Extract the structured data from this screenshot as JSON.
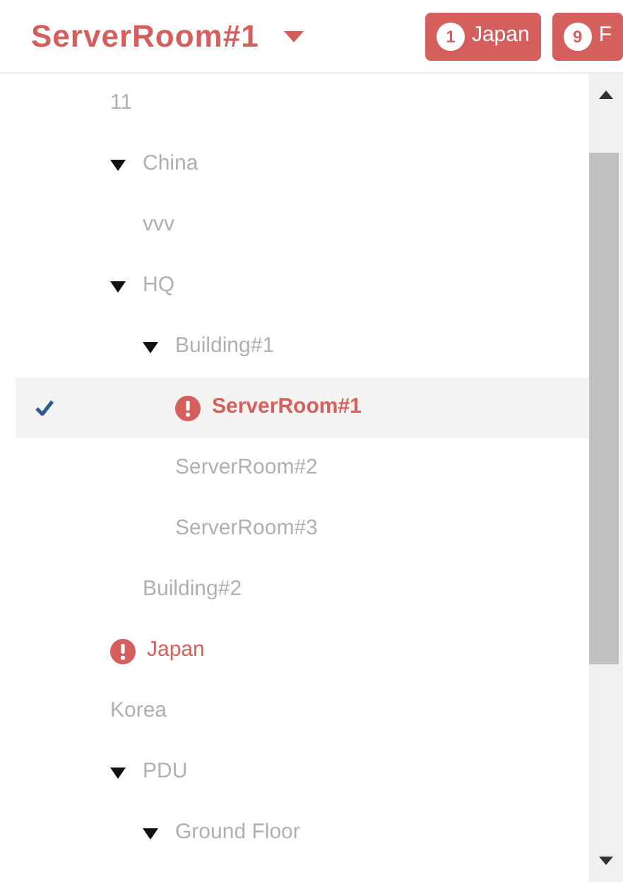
{
  "header": {
    "title": "ServerRoom#1",
    "badges": [
      {
        "count": "1",
        "label": "Japan"
      },
      {
        "count": "9",
        "label": "F"
      }
    ]
  },
  "tree": [
    {
      "label": "11",
      "selected": false,
      "alert": false
    },
    {
      "label": "China",
      "selected": false,
      "alert": false,
      "expanded": true,
      "children": [
        {
          "label": "vvv",
          "selected": false,
          "alert": false
        }
      ]
    },
    {
      "label": "HQ",
      "selected": false,
      "alert": false,
      "expanded": true,
      "children": [
        {
          "label": "Building#1",
          "selected": false,
          "alert": false,
          "expanded": true,
          "children": [
            {
              "label": "ServerRoom#1",
              "selected": true,
              "alert": true
            },
            {
              "label": "ServerRoom#2",
              "selected": false,
              "alert": false
            },
            {
              "label": "ServerRoom#3",
              "selected": false,
              "alert": false
            }
          ]
        },
        {
          "label": "Building#2",
          "selected": false,
          "alert": false
        }
      ]
    },
    {
      "label": "Japan",
      "selected": false,
      "alert": true
    },
    {
      "label": "Korea",
      "selected": false,
      "alert": false
    },
    {
      "label": "PDU",
      "selected": false,
      "alert": false,
      "expanded": true,
      "children": [
        {
          "label": "Ground Floor",
          "selected": false,
          "alert": false,
          "expanded": true
        }
      ]
    }
  ]
}
